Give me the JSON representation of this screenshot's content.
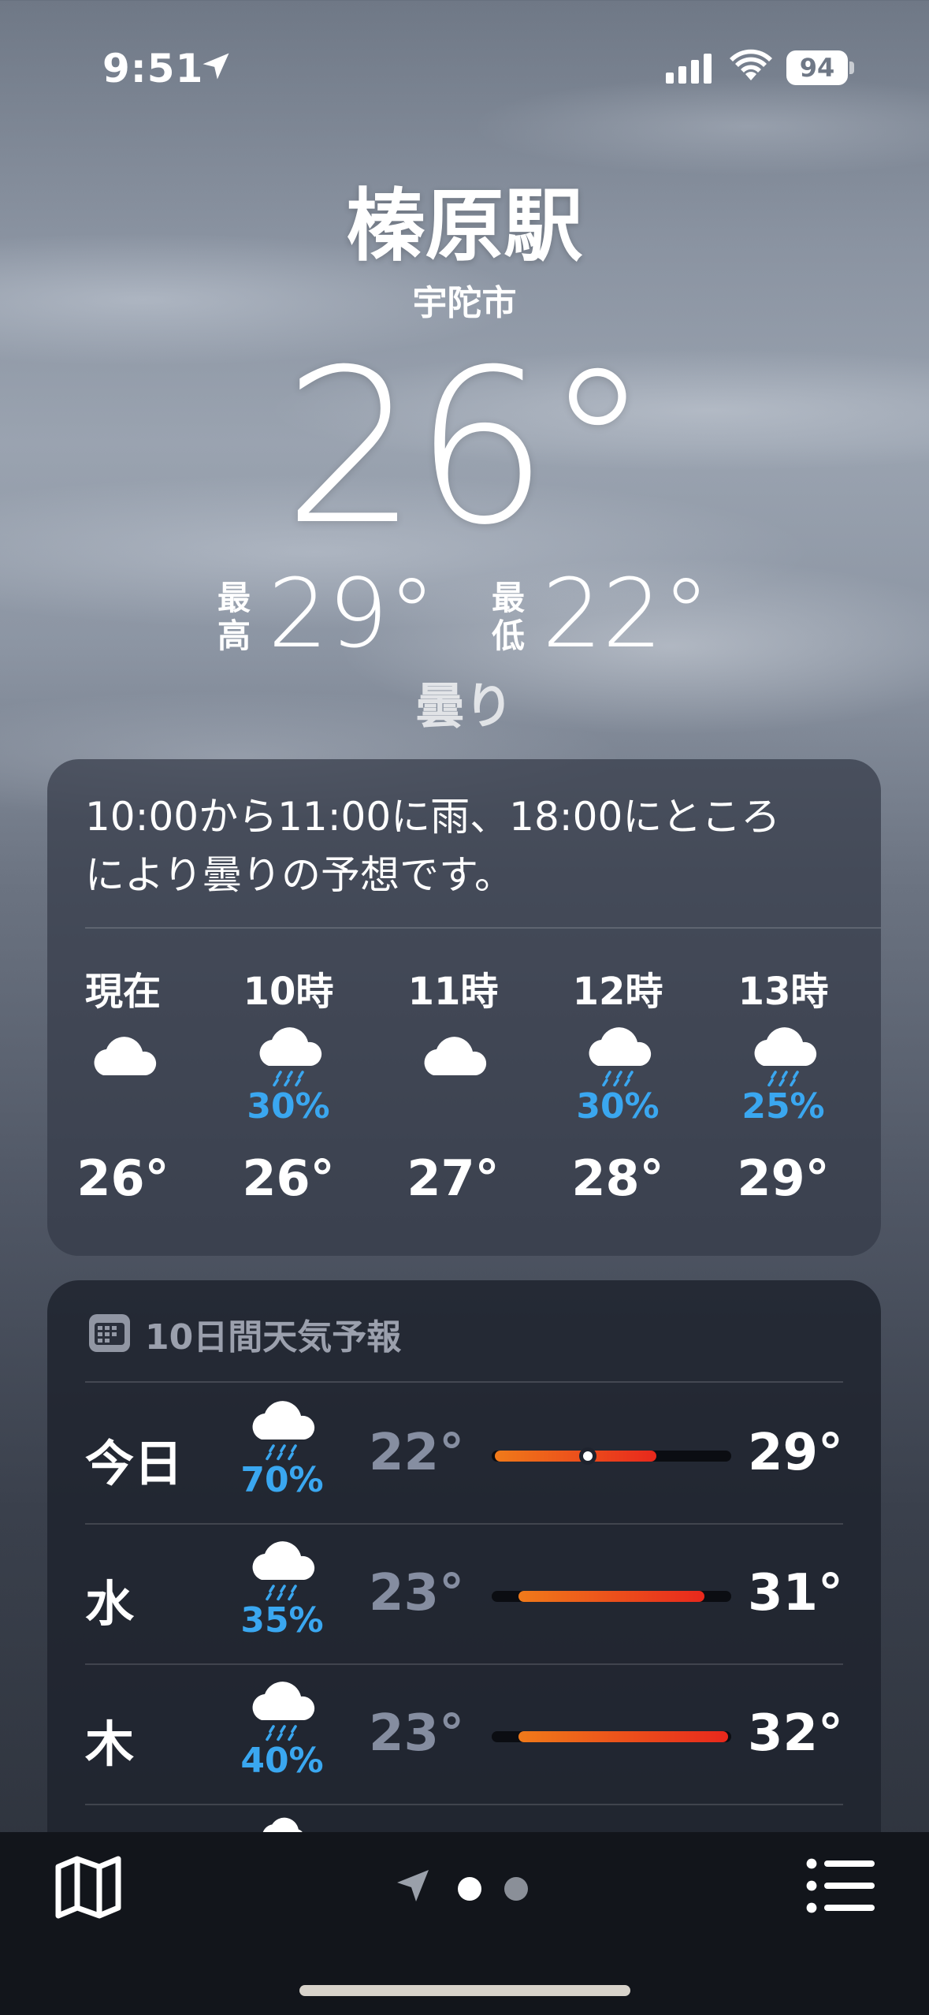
{
  "status_bar": {
    "time": "9:51",
    "battery": "94"
  },
  "location": {
    "name": "榛原駅",
    "sub": "宇陀市"
  },
  "current": {
    "temp": "26°",
    "high_label_1": "最",
    "high_label_2": "高",
    "high": "29°",
    "low_label_1": "最",
    "low_label_2": "低",
    "low": "22°",
    "condition": "曇り"
  },
  "hourly": {
    "summary_line1": "10:00から11:00に雨、18:00にところ",
    "summary_line2": "により曇りの予想です。",
    "items": [
      {
        "label": "現在",
        "icon": "cloud-icon",
        "pct": "",
        "temp": "26°"
      },
      {
        "label": "10時",
        "icon": "cloud-rain-icon",
        "pct": "30%",
        "temp": "26°"
      },
      {
        "label": "11時",
        "icon": "cloud-icon",
        "pct": "",
        "temp": "27°"
      },
      {
        "label": "12時",
        "icon": "cloud-rain-icon",
        "pct": "30%",
        "temp": "28°"
      },
      {
        "label": "13時",
        "icon": "cloud-rain-icon",
        "pct": "25%",
        "temp": "29°"
      }
    ]
  },
  "daily": {
    "title": "10日間天気予報",
    "range_min": 22,
    "range_max": 32,
    "items": [
      {
        "day": "今日",
        "icon": "cloud-rain-icon",
        "pct": "70%",
        "low": "22°",
        "high": "29°",
        "low_value": 22,
        "high_value": 29,
        "current_value": 26
      },
      {
        "day": "水",
        "icon": "cloud-rain-icon",
        "pct": "35%",
        "low": "23°",
        "high": "31°",
        "low_value": 23,
        "high_value": 31
      },
      {
        "day": "木",
        "icon": "cloud-rain-icon",
        "pct": "40%",
        "low": "23°",
        "high": "32°",
        "low_value": 23,
        "high_value": 32
      }
    ]
  },
  "colors": {
    "precip": "#3aa7f0",
    "bar_warm": "#f07a1a",
    "bar_hot": "#e8281c"
  },
  "toolbar": {
    "left_icon": "map-icon",
    "right_icon": "list-icon",
    "pages": 2,
    "current_page": 1
  }
}
